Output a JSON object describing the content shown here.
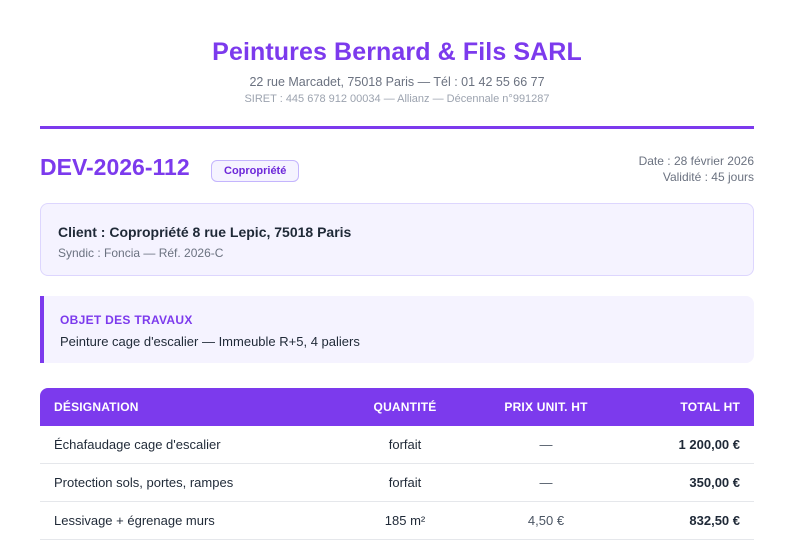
{
  "company": {
    "name": "Peintures Bernard & Fils SARL",
    "address": "22 rue Marcadet, 75018 Paris — Tél : 01 42 55 66 77",
    "siret": "SIRET : 445 678 912 00034 — Allianz — Décennale n°991287"
  },
  "quote": {
    "number": "DEV-2026-112",
    "badge": "Copropriété",
    "date": "Date : 28 février 2026",
    "validity": "Validité : 45 jours"
  },
  "client": {
    "name": "Client : Copropriété 8 rue Lepic, 75018 Paris",
    "sub": "Syndic : Foncia — Réf. 2026-C"
  },
  "objet": {
    "title": "OBJET DES TRAVAUX",
    "text": "Peinture cage d'escalier — Immeuble R+5, 4 paliers"
  },
  "colors": {
    "accent": "#7c3aed",
    "panel": "#f5f3ff"
  },
  "table": {
    "headers": [
      "DÉSIGNATION",
      "QUANTITÉ",
      "PRIX UNIT. HT",
      "TOTAL HT"
    ],
    "rows": [
      [
        "Échafaudage cage d'escalier",
        "forfait",
        "—",
        "1 200,00 €"
      ],
      [
        "Protection sols, portes, rampes",
        "forfait",
        "—",
        "350,00 €"
      ],
      [
        "Lessivage + égrenage murs",
        "185 m²",
        "4,50 €",
        "832,50 €"
      ]
    ]
  }
}
